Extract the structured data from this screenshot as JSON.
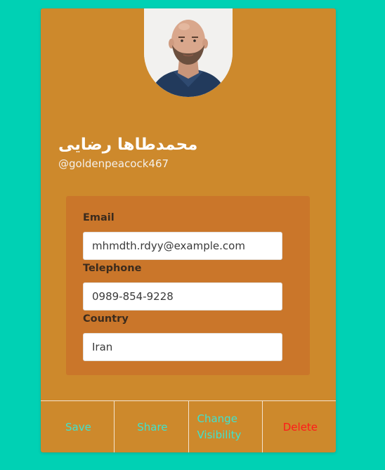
{
  "profile": {
    "name": "محمدطاها رضایی",
    "handle": "@goldenpeacock467",
    "avatar_alt": "profile photo of a bald bearded man"
  },
  "fields": {
    "email": {
      "label": "Email",
      "value": "mhmdth.rdyy@example.com"
    },
    "telephone": {
      "label": "Telephone",
      "value": "0989-854-9228"
    },
    "country": {
      "label": "Country",
      "value": "Iran"
    }
  },
  "actions": {
    "save": "Save",
    "share": "Share",
    "change_visibility": "Change Visibility",
    "delete": "Delete"
  },
  "colors": {
    "page_background": "#00d1b4",
    "card_background": "#cd892c",
    "info_box_background": "#ca762a",
    "action_text": "#3ee3cf",
    "delete_text": "#ff1a1a"
  }
}
